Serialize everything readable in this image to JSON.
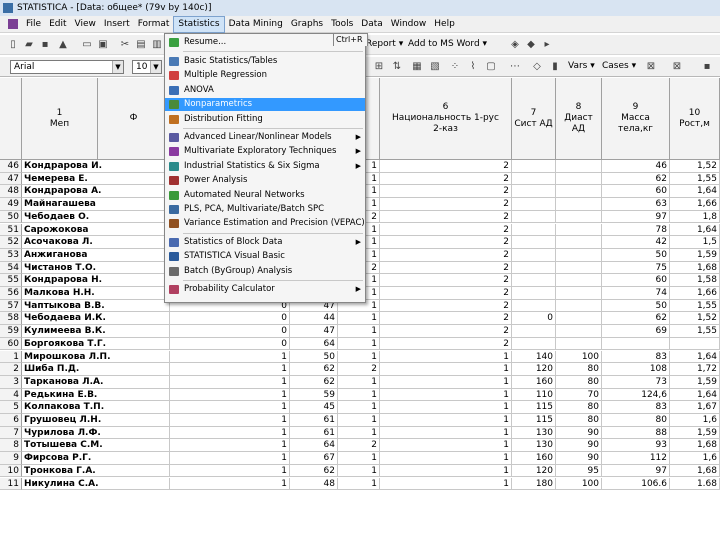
{
  "window": {
    "title": "STATISTICA - [Data: общее* (79v by 140c)]"
  },
  "menubar": {
    "items": [
      "File",
      "Edit",
      "View",
      "Insert",
      "Format",
      "Statistics",
      "Data Mining",
      "Graphs",
      "Tools",
      "Data",
      "Window",
      "Help"
    ]
  },
  "toolbar": {
    "report_label": "Report ▾",
    "addto_word_label": "Add to MS Word ▾",
    "font_name": "Arial",
    "font_size": "10",
    "vars_label": "Vars ▾",
    "cases_label": "Cases ▾"
  },
  "statistics_menu": {
    "resume": {
      "label": "Resume...",
      "shortcut": "Ctrl+R"
    },
    "items": [
      {
        "label": "Basic Statistics/Tables",
        "icon_color": "#4a7ab5"
      },
      {
        "label": "Multiple Regression",
        "icon_color": "#d04040"
      },
      {
        "label": "ANOVA",
        "icon_color": "#3b6fb6"
      },
      {
        "label": "Nonparametrics",
        "icon_color": "#4a8a3a",
        "highlighted": true
      },
      {
        "label": "Distribution Fitting",
        "icon_color": "#c07020"
      },
      {
        "label": "Advanced Linear/Nonlinear Models",
        "icon_color": "#5a5aa0",
        "submenu": true
      },
      {
        "label": "Multivariate Exploratory Techniques",
        "icon_color": "#8a3aa0",
        "submenu": true
      },
      {
        "label": "Industrial Statistics & Six Sigma",
        "icon_color": "#2a8a8a",
        "submenu": true
      },
      {
        "label": "Power Analysis",
        "icon_color": "#a03030"
      },
      {
        "label": "Automated Neural Networks",
        "icon_color": "#3a9a3a"
      },
      {
        "label": "PLS, PCA, Multivariate/Batch SPC",
        "icon_color": "#3a6aa0"
      },
      {
        "label": "Variance Estimation and Precision (VEPAC)",
        "icon_color": "#905020"
      },
      {
        "label": "Statistics of Block Data",
        "icon_color": "#4a6ab0",
        "submenu": true
      },
      {
        "label": "STATISTICA Visual Basic",
        "icon_color": "#2a5a9a"
      },
      {
        "label": "Batch (ByGroup) Analysis",
        "icon_color": "#6a6a6a"
      },
      {
        "label": "Probability Calculator",
        "icon_color": "#b04060",
        "submenu": true
      }
    ]
  },
  "spreadsheet": {
    "headers": {
      "col1": {
        "num": "1",
        "name": "Меп"
      },
      "col2": {
        "num": "",
        "name": "Ф"
      },
      "col6": {
        "num": "6",
        "name": "Национальность 1-рус 2-каз"
      },
      "col7": {
        "num": "7",
        "name": "Сист АД"
      },
      "col8": {
        "num": "8",
        "name": "Диаст АД"
      },
      "col9": {
        "num": "9",
        "name": "Масса тела,кг"
      },
      "col10": {
        "num": "10",
        "name": "Рост,м"
      }
    },
    "rows": [
      {
        "n": "46",
        "name": "Кондрарова И.",
        "c3": "",
        "c4": "",
        "c5": "1",
        "c6": "2",
        "c7": "",
        "c8": "",
        "c9": "46",
        "c10": "1,52"
      },
      {
        "n": "47",
        "name": "Чемерева Е.",
        "c3": "",
        "c4": "",
        "c5": "1",
        "c6": "2",
        "c7": "",
        "c8": "",
        "c9": "62",
        "c10": "1,55"
      },
      {
        "n": "48",
        "name": "Кондрарова А.",
        "c3": "",
        "c4": "",
        "c5": "1",
        "c6": "2",
        "c7": "",
        "c8": "",
        "c9": "60",
        "c10": "1,64"
      },
      {
        "n": "49",
        "name": "Майнагашева",
        "c3": "",
        "c4": "",
        "c5": "1",
        "c6": "2",
        "c7": "",
        "c8": "",
        "c9": "63",
        "c10": "1,66"
      },
      {
        "n": "50",
        "name": "Чебодаев О.",
        "c3": "",
        "c4": "",
        "c5": "2",
        "c6": "2",
        "c7": "",
        "c8": "",
        "c9": "97",
        "c10": "1,8"
      },
      {
        "n": "51",
        "name": "Сарожокова",
        "c3": "",
        "c4": "",
        "c5": "1",
        "c6": "2",
        "c7": "",
        "c8": "",
        "c9": "78",
        "c10": "1,64"
      },
      {
        "n": "52",
        "name": "Асочакова Л.",
        "c3": "",
        "c4": "",
        "c5": "1",
        "c6": "2",
        "c7": "",
        "c8": "",
        "c9": "42",
        "c10": "1,5"
      },
      {
        "n": "53",
        "name": "Анжиганова",
        "c3": "",
        "c4": "",
        "c5": "1",
        "c6": "2",
        "c7": "",
        "c8": "",
        "c9": "50",
        "c10": "1,59"
      },
      {
        "n": "54",
        "name": "Чистанов Т.О.",
        "c3": "",
        "c4": "",
        "c5": "2",
        "c6": "2",
        "c7": "",
        "c8": "",
        "c9": "75",
        "c10": "1,68"
      },
      {
        "n": "55",
        "name": "Кондрарова Н.",
        "c3": "",
        "c4": "",
        "c5": "1",
        "c6": "2",
        "c7": "",
        "c8": "",
        "c9": "60",
        "c10": "1,58"
      },
      {
        "n": "56",
        "name": "Малкова Н.Н.",
        "c3": "",
        "c4": "",
        "c5": "1",
        "c6": "2",
        "c7": "",
        "c8": "",
        "c9": "74",
        "c10": "1,66"
      },
      {
        "n": "57",
        "name": "Чаптыкова В.В.",
        "c3": "0",
        "c4": "47",
        "c5": "1",
        "c6": "2",
        "c7": "",
        "c8": "",
        "c9": "50",
        "c10": "1,55"
      },
      {
        "n": "58",
        "name": "Чебодаева И.К.",
        "c3": "0",
        "c4": "44",
        "c5": "1",
        "c6": "2",
        "c7": "0",
        "c8": "",
        "c9": "62",
        "c10": "1,52"
      },
      {
        "n": "59",
        "name": "Кулимеева В.К.",
        "c3": "0",
        "c4": "47",
        "c5": "1",
        "c6": "2",
        "c7": "",
        "c8": "",
        "c9": "69",
        "c10": "1,55"
      },
      {
        "n": "60",
        "name": "Боргоякова Т.Г.",
        "c3": "0",
        "c4": "64",
        "c5": "1",
        "c6": "2",
        "c7": "",
        "c8": "",
        "c9": "",
        "c10": ""
      },
      {
        "n": "1",
        "name": "Мирошкова Л.П.",
        "c3": "1",
        "c4": "50",
        "c5": "1",
        "c6": "1",
        "c7": "140",
        "c8": "100",
        "c9": "83",
        "c10": "1,64"
      },
      {
        "n": "2",
        "name": "Шиба П.Д.",
        "c3": "1",
        "c4": "62",
        "c5": "2",
        "c6": "1",
        "c7": "120",
        "c8": "80",
        "c9": "108",
        "c10": "1,72"
      },
      {
        "n": "3",
        "name": "Тарканова Л.А.",
        "c3": "1",
        "c4": "62",
        "c5": "1",
        "c6": "1",
        "c7": "160",
        "c8": "80",
        "c9": "73",
        "c10": "1,59"
      },
      {
        "n": "4",
        "name": "Редькина Е.В.",
        "c3": "1",
        "c4": "59",
        "c5": "1",
        "c6": "1",
        "c7": "110",
        "c8": "70",
        "c9": "124,6",
        "c10": "1,64"
      },
      {
        "n": "5",
        "name": "Колпакова Т.П.",
        "c3": "1",
        "c4": "45",
        "c5": "1",
        "c6": "1",
        "c7": "115",
        "c8": "80",
        "c9": "83",
        "c10": "1,67"
      },
      {
        "n": "6",
        "name": "Грушовец Л.Н.",
        "c3": "1",
        "c4": "61",
        "c5": "1",
        "c6": "1",
        "c7": "115",
        "c8": "80",
        "c9": "80",
        "c10": "1,6"
      },
      {
        "n": "7",
        "name": "Чурилова Л.Ф.",
        "c3": "1",
        "c4": "61",
        "c5": "1",
        "c6": "1",
        "c7": "130",
        "c8": "90",
        "c9": "88",
        "c10": "1,59"
      },
      {
        "n": "8",
        "name": "Тотышева С.М.",
        "c3": "1",
        "c4": "64",
        "c5": "2",
        "c6": "1",
        "c7": "130",
        "c8": "90",
        "c9": "93",
        "c10": "1,68"
      },
      {
        "n": "9",
        "name": "Фирсова Р.Г.",
        "c3": "1",
        "c4": "67",
        "c5": "1",
        "c6": "1",
        "c7": "160",
        "c8": "90",
        "c9": "112",
        "c10": "1,6"
      },
      {
        "n": "10",
        "name": "Тронкова Г.А.",
        "c3": "1",
        "c4": "62",
        "c5": "1",
        "c6": "1",
        "c7": "120",
        "c8": "95",
        "c9": "97",
        "c10": "1,68"
      },
      {
        "n": "11",
        "name": "Никулина С.А.",
        "c3": "1",
        "c4": "48",
        "c5": "1",
        "c6": "1",
        "c7": "180",
        "c8": "100",
        "c9": "106.6",
        "c10": "1.68"
      }
    ]
  }
}
